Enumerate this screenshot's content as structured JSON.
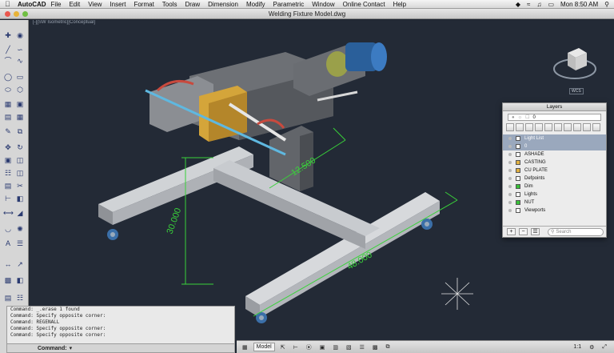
{
  "menubar": {
    "app": "AutoCAD",
    "items": [
      "File",
      "Edit",
      "View",
      "Insert",
      "Format",
      "Tools",
      "Draw",
      "Dimension",
      "Modify",
      "Parametric",
      "Window",
      "Online Contact",
      "Help"
    ],
    "clock": "Mon 8:50 AM"
  },
  "window": {
    "title": "Welding Fixture Model.dwg"
  },
  "viewport": {
    "label": "[-][SW Isometric][Conceptual]",
    "dimensions": [
      "12.500",
      "30.000",
      "48.000"
    ],
    "wcs_label": "WCS"
  },
  "layers_palette": {
    "title": "Layers",
    "current_layer": "0",
    "rows": [
      {
        "name": "Light List",
        "selected": true,
        "color": "#ffffff"
      },
      {
        "name": "0",
        "selected": true,
        "color": "#ffffff"
      },
      {
        "name": "ASHADE",
        "selected": false,
        "color": "#ffffff"
      },
      {
        "name": "CASTING",
        "selected": false,
        "color": "#e0b040"
      },
      {
        "name": "CU PLATE",
        "selected": false,
        "color": "#e0b040"
      },
      {
        "name": "Defpoints",
        "selected": false,
        "color": "#ffffff"
      },
      {
        "name": "Dim",
        "selected": false,
        "color": "#38c038"
      },
      {
        "name": "Lights",
        "selected": false,
        "color": "#ffffff"
      },
      {
        "name": "NUT",
        "selected": false,
        "color": "#38c038"
      },
      {
        "name": "Viewports",
        "selected": false,
        "color": "#ffffff"
      }
    ],
    "search_placeholder": "Search"
  },
  "command_window": {
    "history": [
      "Command: _.erase 1 found",
      "Command: Specify opposite corner:",
      "Command: REGENALL",
      "Command: Specify opposite corner:",
      "Command: Specify opposite corner:"
    ],
    "prompt": "Command:"
  },
  "status_bar": {
    "model_tab": "Model",
    "scale": "1:1"
  },
  "colors": {
    "viewport_bg": "#232a36",
    "dimension": "#39d23a",
    "steel": "#c4c7cb",
    "dark_steel": "#55585d",
    "brass": "#d4a53a",
    "blue_motor": "#2a5f9a"
  }
}
